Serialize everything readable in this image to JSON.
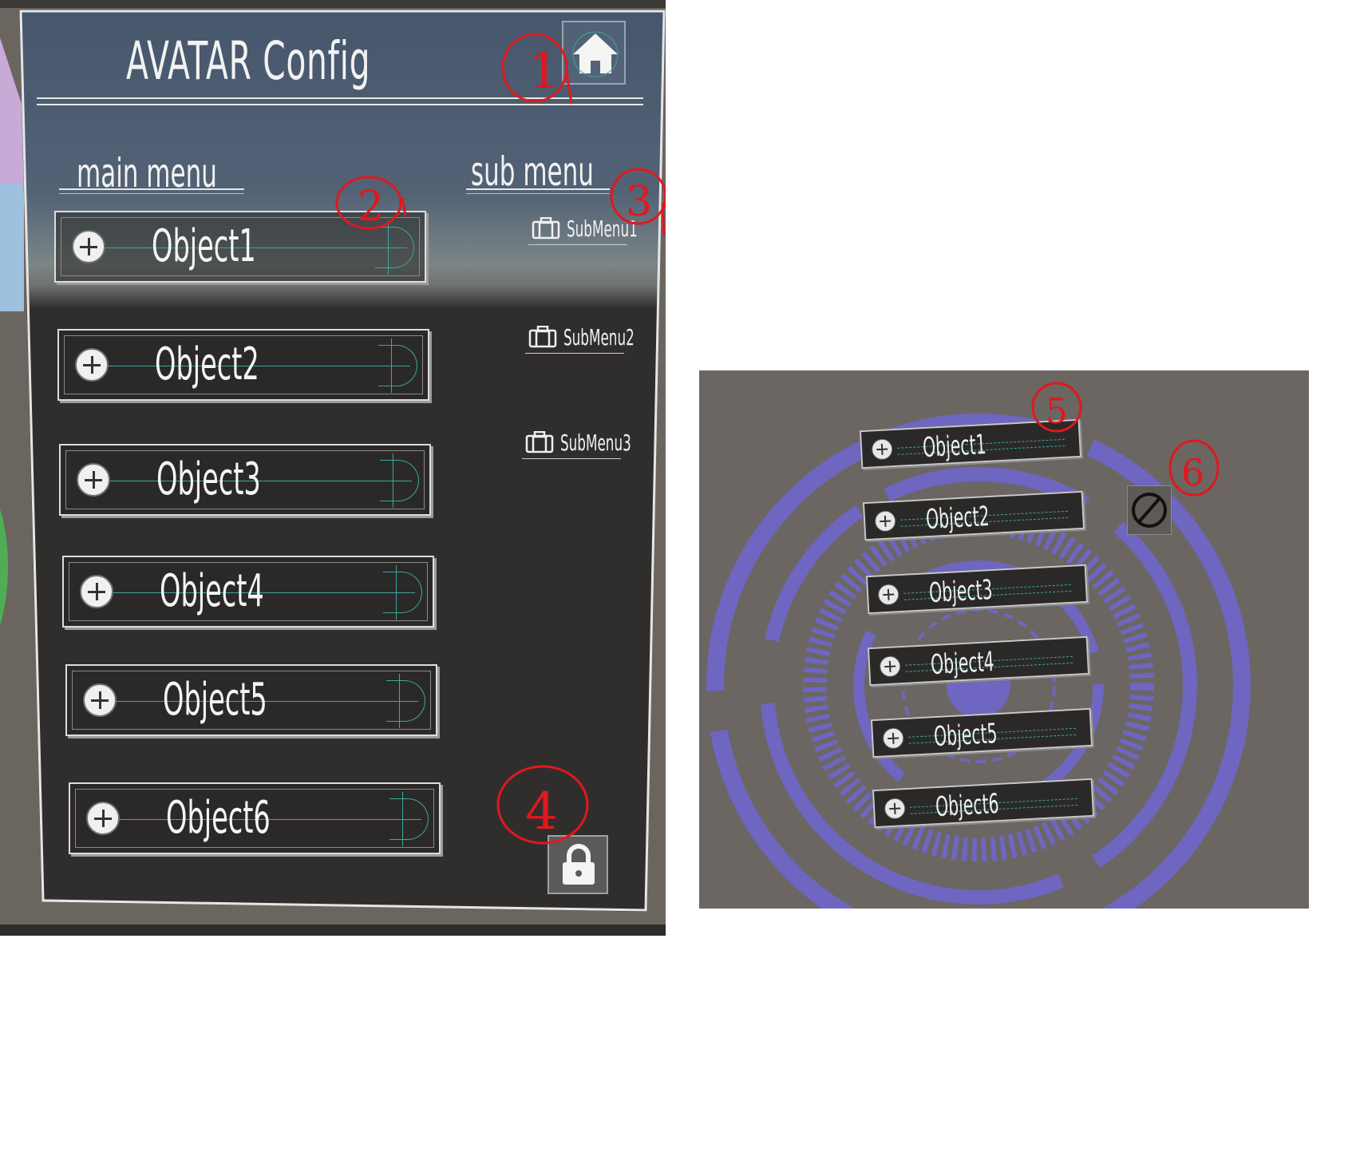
{
  "left_panel": {
    "title": "AVATAR Config",
    "main_menu_label": "main menu",
    "sub_menu_label": "sub menu",
    "objects": [
      "Object1",
      "Object2",
      "Object3",
      "Object4",
      "Object5",
      "Object6"
    ],
    "submenus": [
      "SubMenu1",
      "SubMenu2",
      "SubMenu3"
    ],
    "annotations": [
      "1",
      "2",
      "3",
      "4"
    ]
  },
  "right_panel": {
    "objects": [
      "Object1",
      "Object2",
      "Object3",
      "Object4",
      "Object5",
      "Object6"
    ],
    "annotations": [
      "5",
      "6"
    ]
  },
  "icons": {
    "home": "home-icon",
    "add": "plus-circle-icon",
    "submenu": "briefcase-icon",
    "lock": "lock-icon",
    "cancel": "prohibited-icon"
  },
  "colors": {
    "annotation_red": "#e0181e",
    "ring_purple": "#6e66c0",
    "teal_guide": "#3aa89c",
    "panel_dark": "#302e2d",
    "panel_header": "#46566c"
  }
}
